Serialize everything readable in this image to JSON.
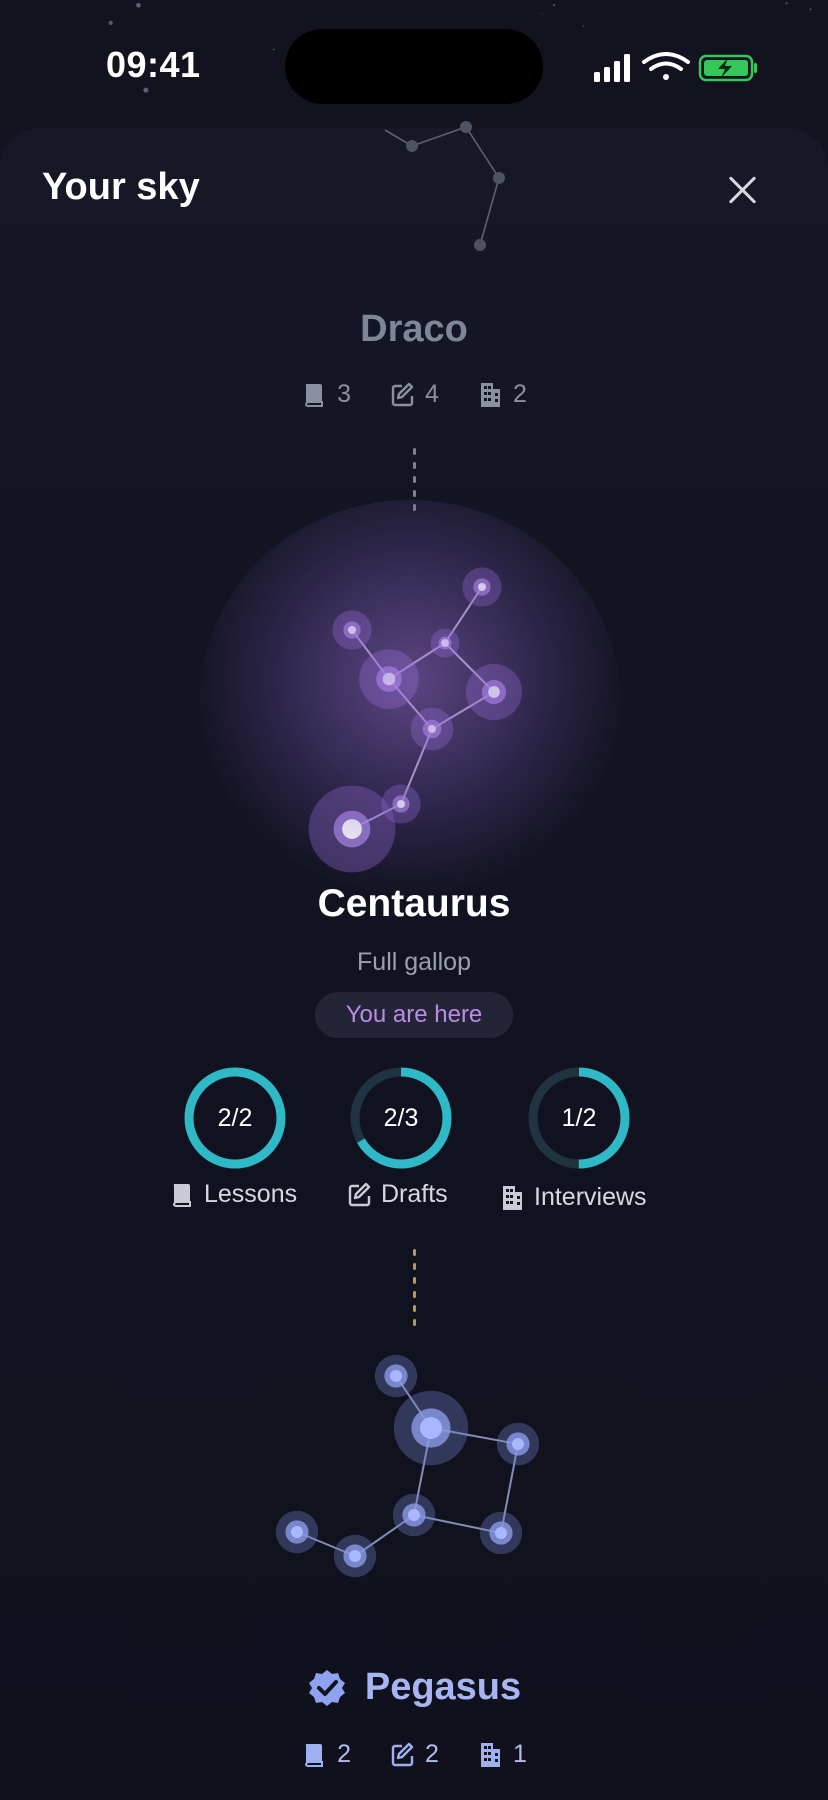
{
  "status_bar": {
    "time": "09:41",
    "signal": "signal-bars-icon",
    "wifi": "wifi-icon",
    "battery": "battery-charging-icon",
    "battery_color": "#34c759"
  },
  "sheet": {
    "title": "Your sky",
    "close_icon": "close-icon"
  },
  "constellations": {
    "previous": {
      "name": "Draco",
      "stats": [
        {
          "icon": "book-icon",
          "value": "3"
        },
        {
          "icon": "edit-icon",
          "value": "4"
        },
        {
          "icon": "building-icon",
          "value": "2"
        }
      ]
    },
    "current": {
      "name": "Centaurus",
      "subtitle": "Full gallop",
      "badge": "You are here",
      "accent": "#b98ce6",
      "progress": [
        {
          "label": "Lessons",
          "icon": "book-icon",
          "text": "2/2",
          "done": 2,
          "total": 2
        },
        {
          "label": "Drafts",
          "icon": "edit-icon",
          "text": "2/3",
          "done": 2,
          "total": 3
        },
        {
          "label": "Interviews",
          "icon": "building-icon",
          "text": "1/2",
          "done": 1,
          "total": 2
        }
      ],
      "ring_color": "#2fb8c6"
    },
    "next": {
      "name": "Pegasus",
      "completed_icon": "verified-badge-icon",
      "accent": "#a7b6f3",
      "stats": [
        {
          "icon": "book-icon",
          "value": "2"
        },
        {
          "icon": "edit-icon",
          "value": "2"
        },
        {
          "icon": "building-icon",
          "value": "1"
        }
      ]
    }
  }
}
